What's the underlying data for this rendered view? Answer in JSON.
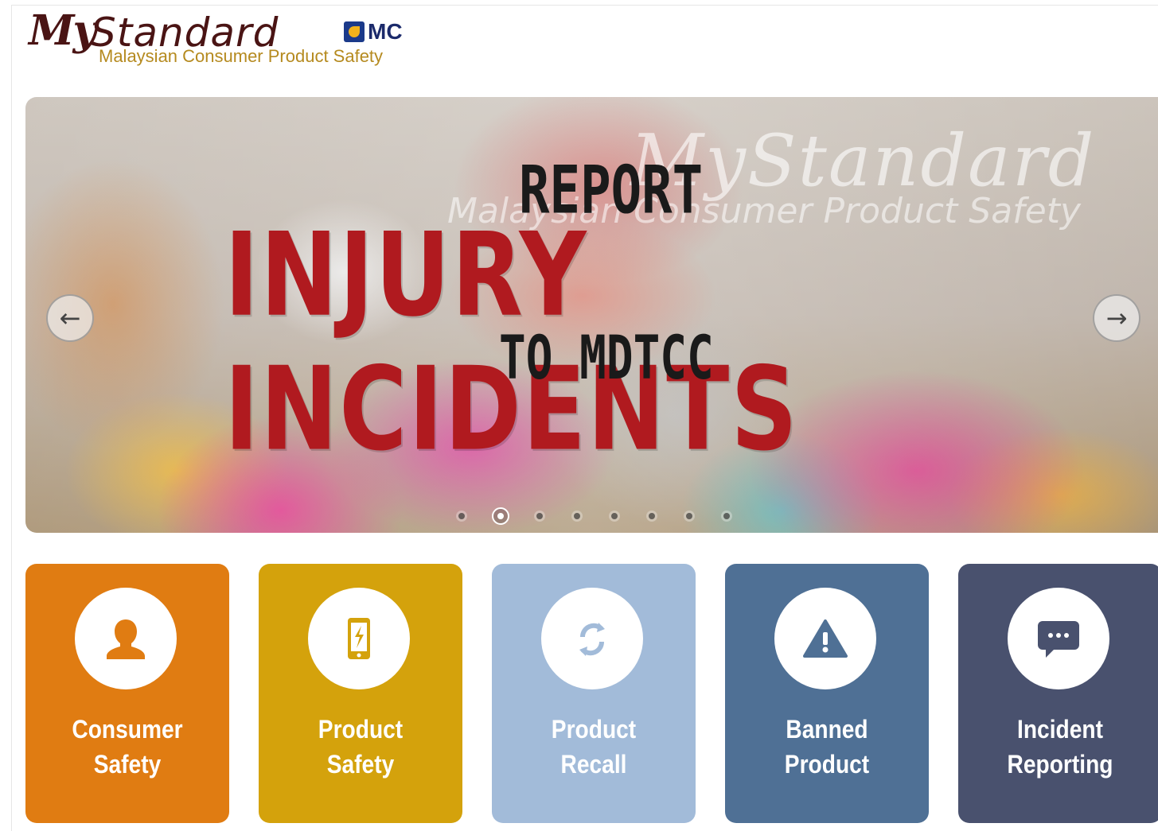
{
  "logo": {
    "my": "My",
    "standard": "Standard",
    "subtitle": "Malaysian Consumer Product Safety",
    "badge": "MC"
  },
  "carousel": {
    "slide": {
      "brand": "MyStandard",
      "brand_sub": "Malaysian Consumer Product Safety",
      "line1": "REPORT",
      "line2": "INJURY INCIDENTS",
      "line3": "TO MDTCC"
    },
    "prev_icon": "arrow-left-icon",
    "next_icon": "arrow-right-icon",
    "dot_count": 8,
    "active_dot": 2
  },
  "tiles": [
    {
      "line1": "Consumer",
      "line2": "Safety",
      "icon": "user-icon",
      "color": "#e07c12"
    },
    {
      "line1": "Product",
      "line2": "Safety",
      "icon": "phone-icon",
      "color": "#d4a20c"
    },
    {
      "line1": "Product",
      "line2": "Recall",
      "icon": "recall-arrows-icon",
      "color": "#a2bbd9"
    },
    {
      "line1": "Banned",
      "line2": "Product",
      "icon": "warning-icon",
      "color": "#4f7095"
    },
    {
      "line1": "Incident",
      "line2": "Reporting",
      "icon": "chat-bubble-icon",
      "color": "#49516e"
    }
  ]
}
